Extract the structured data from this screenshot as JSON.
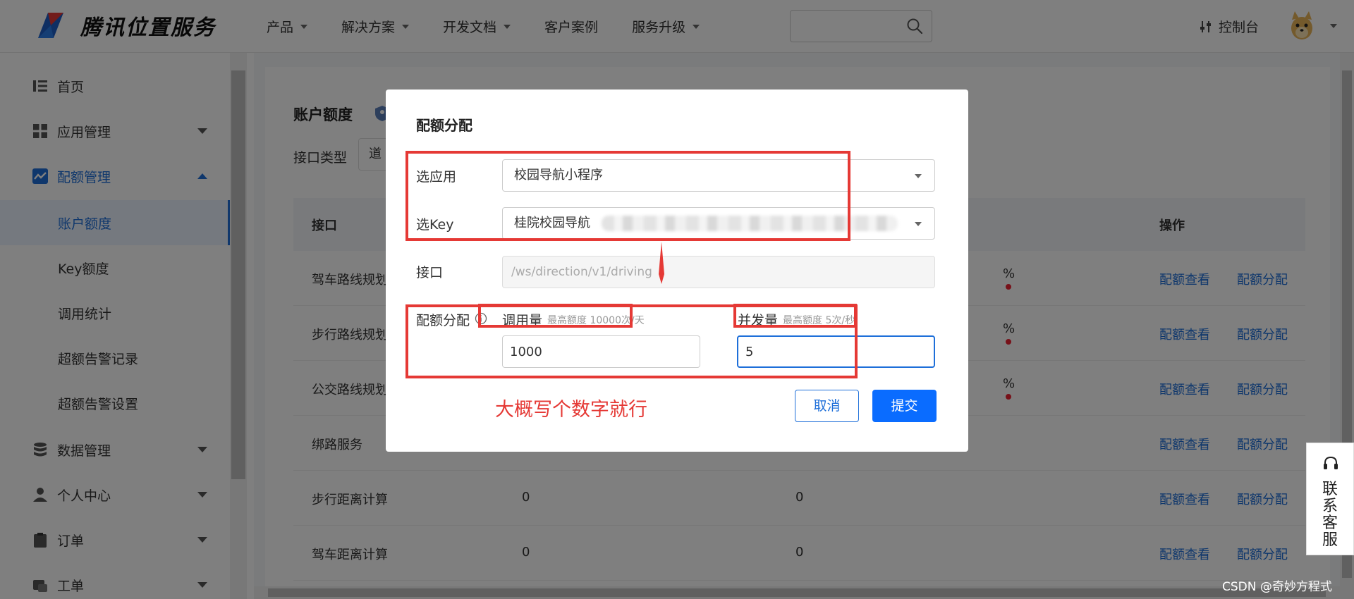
{
  "header": {
    "logo_text": "腾讯位置服务",
    "nav": [
      "产品",
      "解决方案",
      "开发文档",
      "客户案例",
      "服务升级"
    ],
    "nav_has_caret": [
      true,
      true,
      true,
      false,
      true
    ],
    "search_placeholder": "",
    "console_label": "控制台"
  },
  "sidebar": {
    "home": "首页",
    "app_mgmt": "应用管理",
    "quota_mgmt": "配额管理",
    "sub": [
      "账户额度",
      "Key额度",
      "调用统计",
      "超额告警记录",
      "超额告警设置"
    ],
    "data_mgmt": "数据管理",
    "personal": "个人中心",
    "orders": "订单",
    "tickets": "工单"
  },
  "main": {
    "title": "账户额度",
    "filter_label": "接口类型",
    "filter_value": "道",
    "col_api": "接口",
    "col_op": "操作",
    "rows": [
      {
        "api": "驾车路线规划",
        "v1": "",
        "v2": "",
        "pct": "%",
        "dot": true
      },
      {
        "api": "步行路线规划",
        "v1": "",
        "v2": "",
        "pct": "%",
        "dot": true
      },
      {
        "api": "公交路线规划",
        "v1": "",
        "v2": "",
        "pct": "%",
        "dot": true
      },
      {
        "api": "绑路服务",
        "v1": "",
        "v2": "",
        "pct": "",
        "dot": false
      },
      {
        "api": "步行距离计算",
        "v1": "0",
        "v2": "0",
        "pct": "",
        "dot": false
      },
      {
        "api": "驾车距离计算",
        "v1": "0",
        "v2": "0",
        "pct": "",
        "dot": false
      }
    ],
    "op_view": "配额查看",
    "op_assign": "配额分配"
  },
  "dialog": {
    "title": "配额分配",
    "app_label": "选应用",
    "app_value": "校园导航小程序",
    "key_label": "选Key",
    "key_value": "桂院校园导航",
    "api_label": "接口",
    "api_value": "/ws/direction/v1/driving",
    "quota_label": "配额分配",
    "calls_label": "调用量",
    "calls_hint": "最高额度 10000次/天",
    "calls_value": "1000",
    "concurrency_label": "并发量",
    "concurrency_hint": "最高额度 5次/秒",
    "concurrency_value": "5",
    "annotation": "大概写个数字就行",
    "cancel": "取消",
    "submit": "提交"
  },
  "service": {
    "label": "联系客服"
  },
  "watermark": "CSDN @奇妙方程式",
  "colors": {
    "accent": "#1e6fd9",
    "primary_button": "#0a6cff",
    "annotation_red": "#e53935"
  }
}
